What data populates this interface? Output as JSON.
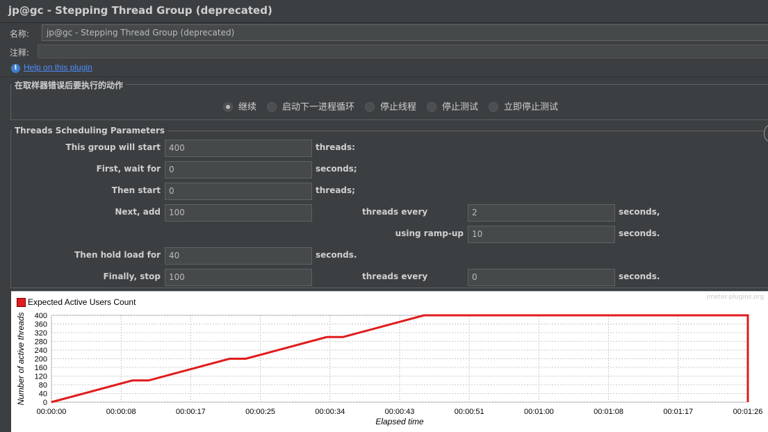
{
  "window": {
    "title": "jp@gc - Stepping Thread Group (deprecated)"
  },
  "form": {
    "name_label": "名称:",
    "name_value": "jp@gc - Stepping Thread Group (deprecated)",
    "comment_label": "注释:",
    "comment_value": "",
    "help_link": "Help on this plugin"
  },
  "sampler_error": {
    "title": "在取样器错误后要执行的动作",
    "options": [
      "继续",
      "启动下一进程循环",
      "停止线程",
      "停止测试",
      "立即停止测试"
    ],
    "selected": "继续"
  },
  "scheduling": {
    "title": "Threads Scheduling Parameters",
    "start_label": "This group will start",
    "start_value": "400",
    "start_unit": "threads:",
    "wait_label": "First, wait for",
    "wait_value": "0",
    "wait_unit": "seconds;",
    "then_start_label": "Then start",
    "then_start_value": "0",
    "then_start_unit": "threads;",
    "next_add_label": "Next, add",
    "next_add_value": "100",
    "threads_every_label": "threads every",
    "threads_every_value": "2",
    "threads_every_unit": "seconds,",
    "rampup_label": "using ramp-up",
    "rampup_value": "10",
    "rampup_unit": "seconds.",
    "hold_label": "Then hold load for",
    "hold_value": "40",
    "hold_unit": "seconds.",
    "stop_label": "Finally, stop",
    "stop_value": "100",
    "stop_every_label": "threads every",
    "stop_every_value": "0",
    "stop_every_unit": "seconds."
  },
  "colors": {
    "background": "#3c3f41",
    "series": "#e01b1b",
    "link": "#4f8cff"
  },
  "chart_data": {
    "type": "line",
    "watermark": "jmeter-plugins.org",
    "xlabel": "Elapsed time",
    "ylabel": "Number of active threads",
    "xlim": [
      0,
      86
    ],
    "ylim": [
      0,
      400
    ],
    "y_ticks": [
      0,
      40,
      80,
      120,
      160,
      200,
      240,
      280,
      320,
      360,
      400
    ],
    "x_ticks": [
      {
        "v": 0,
        "label": "00:00:00"
      },
      {
        "v": 8.6,
        "label": "00:00:08"
      },
      {
        "v": 17.2,
        "label": "00:00:17"
      },
      {
        "v": 25.8,
        "label": "00:00:25"
      },
      {
        "v": 34.4,
        "label": "00:00:34"
      },
      {
        "v": 43,
        "label": "00:00:43"
      },
      {
        "v": 51.6,
        "label": "00:00:51"
      },
      {
        "v": 60.2,
        "label": "00:01:00"
      },
      {
        "v": 68.8,
        "label": "00:01:08"
      },
      {
        "v": 77.4,
        "label": "00:01:17"
      },
      {
        "v": 86,
        "label": "00:01:26"
      }
    ],
    "grid": true,
    "legend": "top-left",
    "series": [
      {
        "name": "Expected Active Users Count",
        "color": "#e01b1b",
        "x": [
          0,
          10,
          12,
          22,
          24,
          34,
          36,
          46,
          86,
          86
        ],
        "y": [
          0,
          100,
          100,
          200,
          200,
          300,
          300,
          400,
          400,
          0
        ]
      }
    ]
  }
}
